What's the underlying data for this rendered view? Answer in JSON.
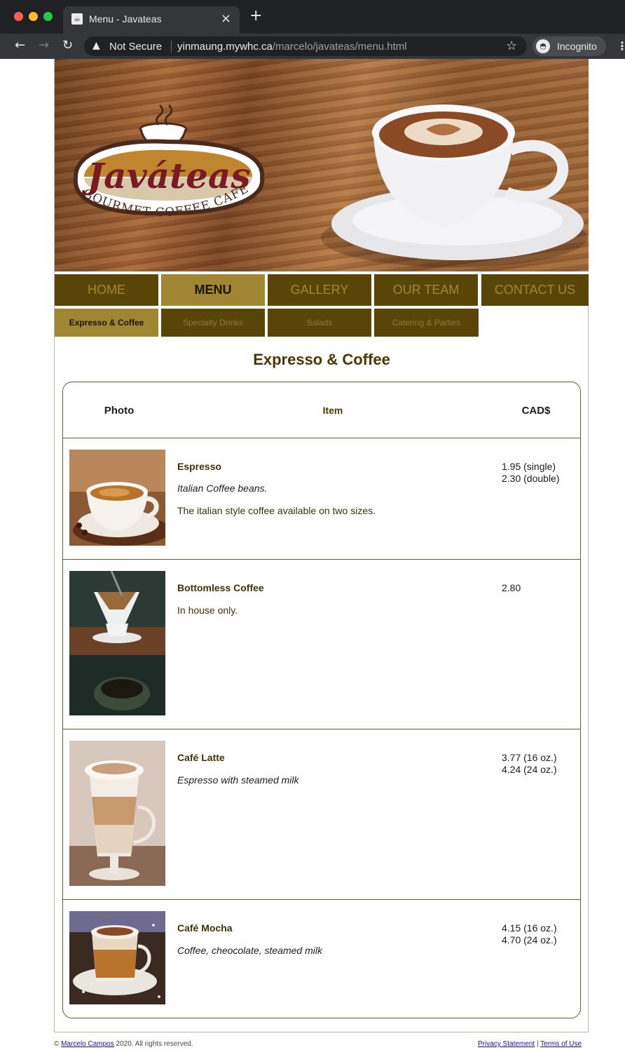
{
  "browser": {
    "tab_title": "Menu - Javateas",
    "tab_favicon": "coffee-cup-icon",
    "not_secure_label": "Not Secure",
    "url_host": "yinmaung.mywhc.ca",
    "url_path": "/marcelo/javateas/menu.html",
    "incognito_label": "Incognito"
  },
  "logo": {
    "brand": "Javáteas",
    "tagline_left": "GOURMET",
    "tagline_mid": "COFFEE",
    "tagline_right": "CAFE"
  },
  "nav": {
    "items": [
      {
        "label": "HOME"
      },
      {
        "label": "MENU"
      },
      {
        "label": "GALLERY"
      },
      {
        "label": "OUR TEAM"
      },
      {
        "label": "CONTACT US"
      }
    ],
    "active": "MENU"
  },
  "subnav": {
    "items": [
      {
        "label": "Expresso & Coffee"
      },
      {
        "label": "Specialty Drinks"
      },
      {
        "label": "Salads"
      },
      {
        "label": "Catering & Parties"
      }
    ],
    "active": "Expresso & Coffee"
  },
  "section_title": "Expresso & Coffee",
  "table": {
    "headers": {
      "photo": "Photo",
      "item": "Item",
      "price": "CAD$"
    },
    "rows": [
      {
        "name": "Espresso",
        "desc1": "Italian Coffee beans.",
        "desc2": "The italian style coffee available on two sizes.",
        "price1": "1.95 (single)",
        "price2": "2.30 (double)"
      },
      {
        "name": "Bottomless Coffee",
        "desc1": "In house only.",
        "price1": "2.80"
      },
      {
        "name": "Café Latte",
        "desc1": "Espresso with steamed milk",
        "price1": "3.77 (16 oz.)",
        "price2": "4.24 (24 oz.)"
      },
      {
        "name": "Café Mocha",
        "desc1": "Coffee, cheocolate, steamed milk",
        "price1": "4.15 (16 oz.)",
        "price2": "4.70 (24 oz.)"
      }
    ]
  },
  "footer": {
    "copyright_symbol": "©",
    "author_link": "Marcelo Campos",
    "rights_text": "2020. All rights reserved.",
    "privacy_link": "Privacy Statement",
    "separator": "|",
    "terms_link": "Terms of Use"
  }
}
